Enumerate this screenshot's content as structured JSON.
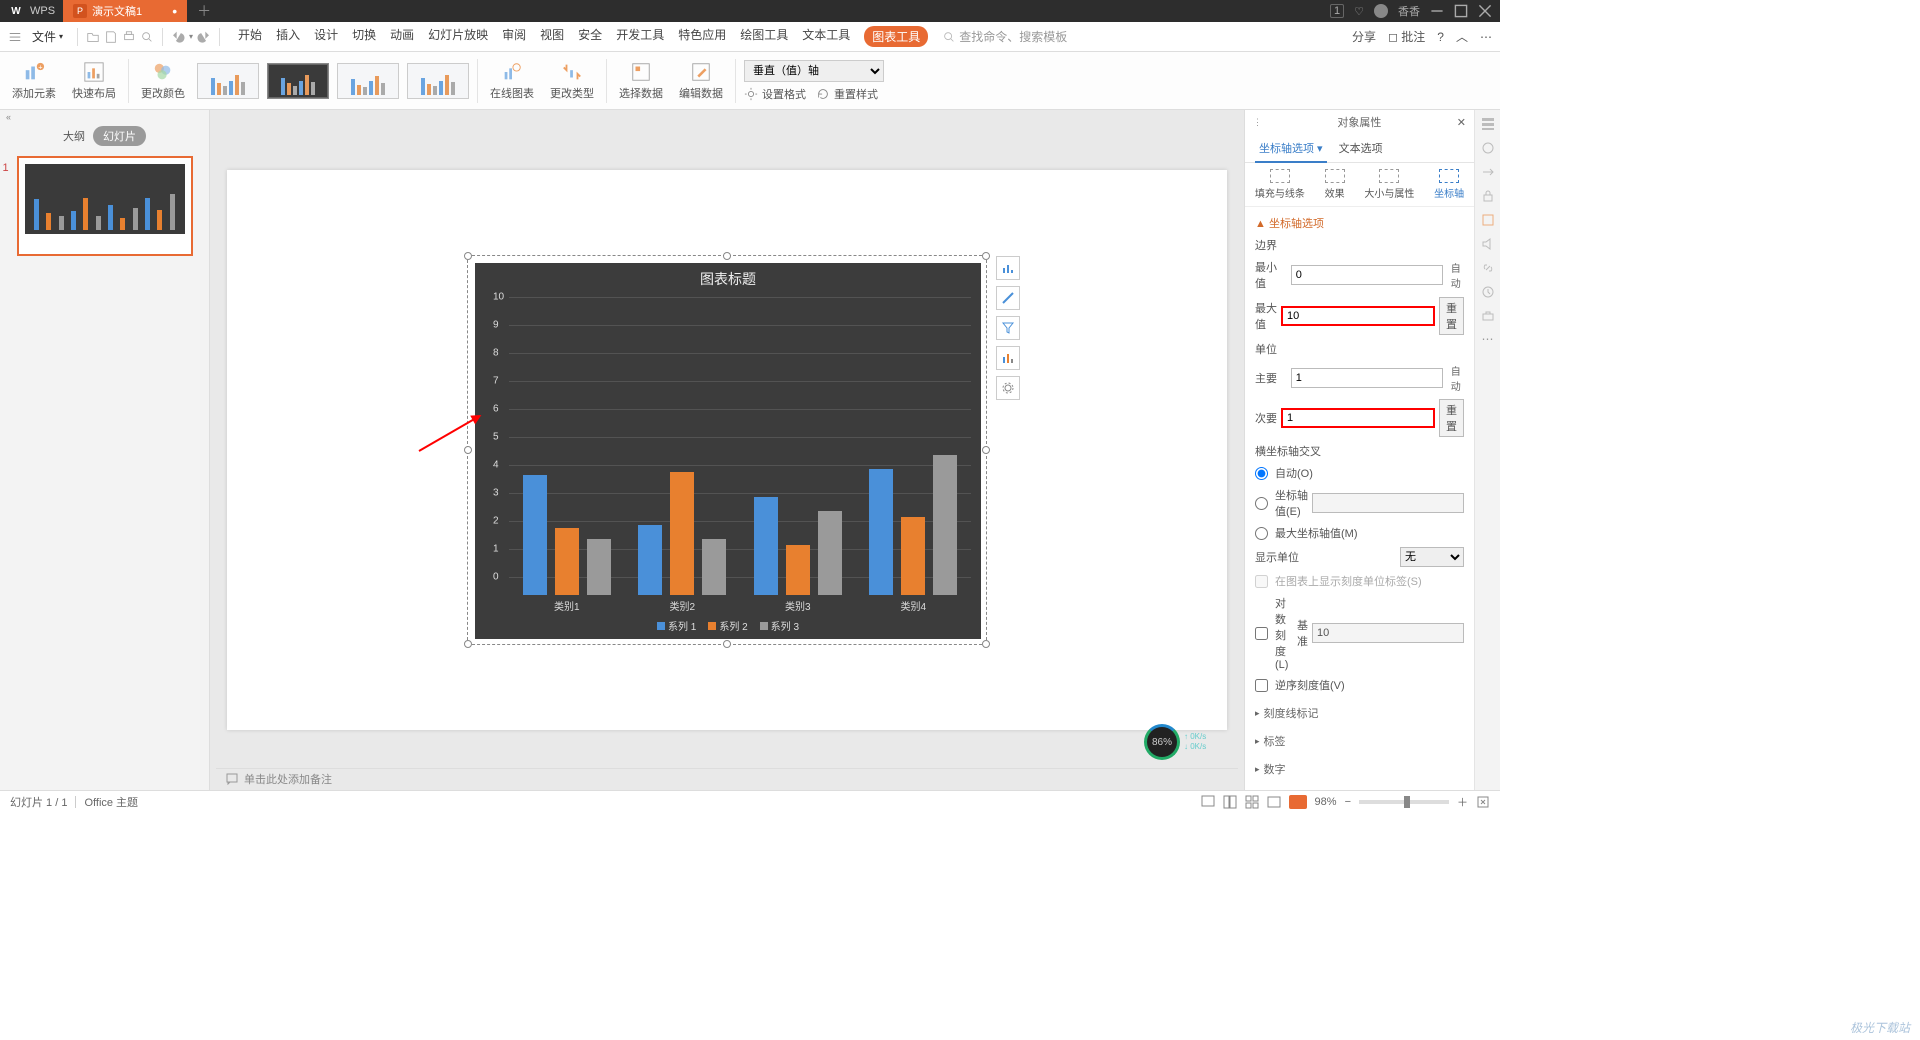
{
  "titlebar": {
    "app": "WPS",
    "filename": "演示文稿1",
    "user": "香香",
    "notif_badge": "1"
  },
  "menubar": {
    "file": "文件",
    "search_placeholder": "查找命令、搜索模板",
    "share": "分享",
    "annotate": "批注"
  },
  "tabs": [
    "开始",
    "插入",
    "设计",
    "切换",
    "动画",
    "幻灯片放映",
    "审阅",
    "视图",
    "安全",
    "开发工具",
    "特色应用",
    "绘图工具",
    "文本工具",
    "图表工具"
  ],
  "ribbon": {
    "add_element": "添加元素",
    "quick_layout": "快速布局",
    "change_colors": "更改颜色",
    "online_chart": "在线图表",
    "change_type": "更改类型",
    "select_data": "选择数据",
    "edit_data": "编辑数据",
    "axis_selected": "垂直（值）轴",
    "set_format": "设置格式",
    "reset_style": "重置样式"
  },
  "thumb": {
    "outline": "大纲",
    "slides": "幻灯片",
    "num": "1"
  },
  "chart_data": {
    "type": "bar",
    "title": "图表标题",
    "categories": [
      "类别1",
      "类别2",
      "类别3",
      "类别4"
    ],
    "series": [
      {
        "name": "系列 1",
        "color": "#4a90d9",
        "values": [
          4.3,
          2.5,
          3.5,
          4.5
        ]
      },
      {
        "name": "系列 2",
        "color": "#e8802f",
        "values": [
          2.4,
          4.4,
          1.8,
          2.8
        ]
      },
      {
        "name": "系列 3",
        "color": "#9a9a9a",
        "values": [
          2.0,
          2.0,
          3.0,
          5.0
        ]
      }
    ],
    "ylim": [
      0,
      10
    ],
    "ymajor": 1
  },
  "rightpane": {
    "title": "对象属性",
    "tab_axis": "坐标轴选项",
    "tab_text": "文本选项",
    "icons": {
      "fill": "填充与线条",
      "effect": "效果",
      "size": "大小与属性",
      "axis": "坐标轴"
    },
    "sect": "坐标轴选项",
    "bounds": "边界",
    "min": "最小值",
    "min_v": "0",
    "min_auto": "自动",
    "max": "最大值",
    "max_v": "10",
    "reset": "重置",
    "units": "单位",
    "major": "主要",
    "major_v": "1",
    "major_auto": "自动",
    "minor": "次要",
    "minor_v": "1",
    "cross": "横坐标轴交叉",
    "auto_o": "自动(O)",
    "axis_val": "坐标轴值(E)",
    "max_axis": "最大坐标轴值(M)",
    "disp_unit": "显示单位",
    "disp_unit_v": "无",
    "disp_label": "在图表上显示刻度单位标签(S)",
    "log": "对数刻度(L)",
    "base": "基准",
    "base_v": "10",
    "reverse": "逆序刻度值(V)",
    "tick": "刻度线标记",
    "label": "标签",
    "number": "数字"
  },
  "notes": "单击此处添加备注",
  "status": {
    "slide": "幻灯片 1 / 1",
    "theme": "Office 主题",
    "zoom": "98%"
  },
  "perf": {
    "pct": "86%",
    "up": "0K/s",
    "down": "0K/s"
  },
  "watermark": "极光下载站"
}
